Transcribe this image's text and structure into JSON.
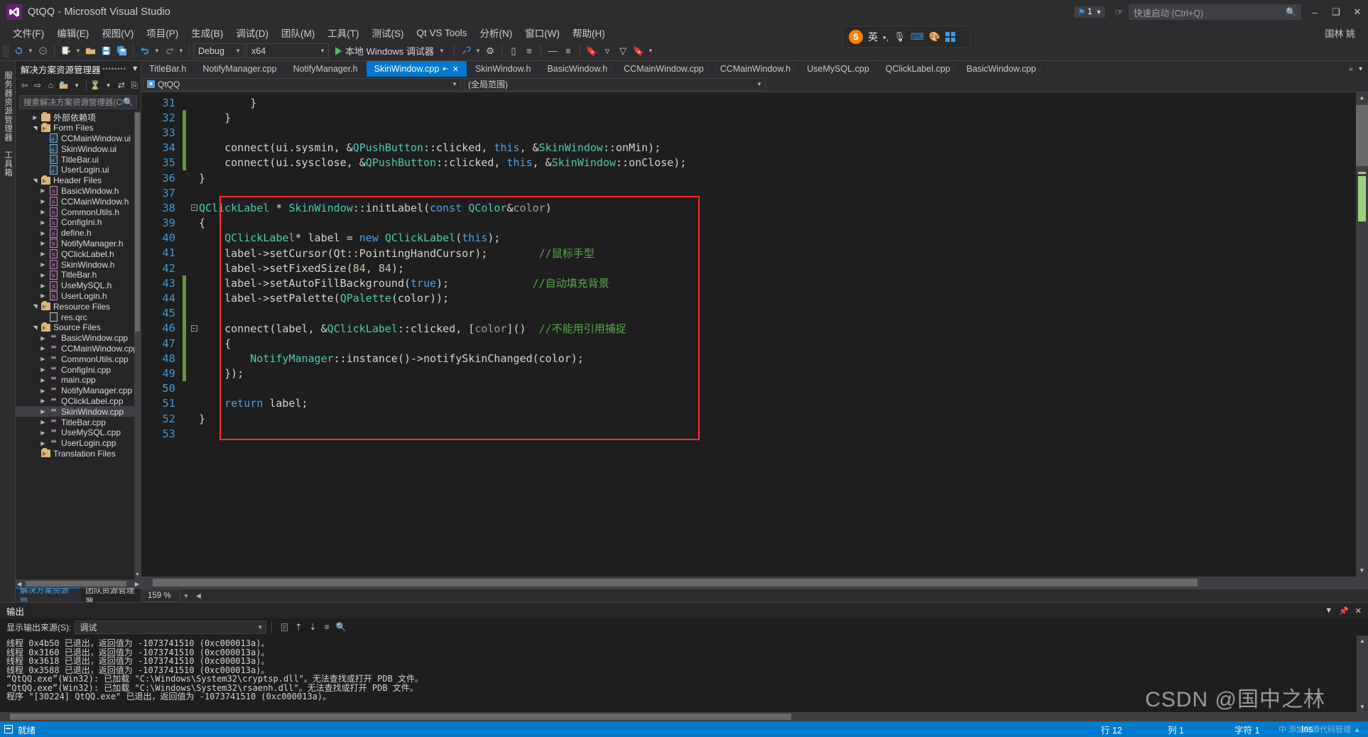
{
  "window": {
    "title": "QtQQ - Microsoft Visual Studio",
    "logo_icon": "visual-studio-logo",
    "notification_count": "1",
    "quick_launch_placeholder": "快速启动 (Ctrl+Q)",
    "user_name": "国林 姚",
    "minimize_label": "–",
    "maximize_label": "❑",
    "close_label": "✕"
  },
  "menu": {
    "items": [
      {
        "label": "文件(F)"
      },
      {
        "label": "编辑(E)"
      },
      {
        "label": "视图(V)"
      },
      {
        "label": "项目(P)"
      },
      {
        "label": "生成(B)"
      },
      {
        "label": "调试(D)"
      },
      {
        "label": "团队(M)"
      },
      {
        "label": "工具(T)"
      },
      {
        "label": "测试(S)"
      },
      {
        "label": "Qt VS Tools"
      },
      {
        "label": "分析(N)"
      },
      {
        "label": "窗口(W)"
      },
      {
        "label": "帮助(H)"
      }
    ]
  },
  "toolbar": {
    "back_icon": "nav-back-icon",
    "forward_icon": "nav-forward-icon",
    "new_item_icon": "new-item-icon",
    "open_icon": "open-file-icon",
    "save_icon": "save-icon",
    "save_all_icon": "save-all-icon",
    "undo_icon": "undo-icon",
    "redo_icon": "redo-icon",
    "config_value": "Debug",
    "platform_value": "x64",
    "run_label": "本地 Windows 调试器",
    "run_icon": "play-icon"
  },
  "ime": {
    "brand_icon": "sogou-logo",
    "mode": "英",
    "dots_icon": "punctuation-icon",
    "mic_icon": "microphone-icon",
    "keyboard_icon": "soft-keyboard-icon",
    "skin_icon": "skin-icon",
    "apps_icon": "toolbox-icon"
  },
  "vstrip": {
    "tabs": [
      {
        "label": "服务器资源管理器"
      },
      {
        "label": "工具箱"
      }
    ]
  },
  "solution_explorer": {
    "title": "解决方案资源管理器",
    "dots": "••••••••",
    "dropdown_icon": "chevron-down-icon",
    "pin_icon": "pin-icon",
    "close_icon": "close-icon",
    "toolbar_icons": [
      "back-icon",
      "forward-icon",
      "home-icon",
      "show-all-files-icon",
      "chevron-down-icon",
      "pending-changes-icon",
      "chevron-down-icon",
      "sync-icon",
      "properties-icon"
    ],
    "search_placeholder": "搜索解决方案资源管理器(Ctrl+;",
    "search_icon": "search-icon",
    "tree": [
      {
        "label": "外部依赖项",
        "depth": 1,
        "arrow": "closed",
        "icon": "folder-ref"
      },
      {
        "label": "Form Files",
        "depth": 1,
        "arrow": "open",
        "icon": "folder-filter"
      },
      {
        "label": "CCMainWindow.ui",
        "depth": 2,
        "arrow": "none",
        "icon": "file-ui"
      },
      {
        "label": "SkinWindow.ui",
        "depth": 2,
        "arrow": "none",
        "icon": "file-ui"
      },
      {
        "label": "TitleBar.ui",
        "depth": 2,
        "arrow": "none",
        "icon": "file-ui"
      },
      {
        "label": "UserLogin.ui",
        "depth": 2,
        "arrow": "none",
        "icon": "file-ui"
      },
      {
        "label": "Header Files",
        "depth": 1,
        "arrow": "open",
        "icon": "folder-filter"
      },
      {
        "label": "BasicWindow.h",
        "depth": 2,
        "arrow": "closed",
        "icon": "file-h"
      },
      {
        "label": "CCMainWindow.h",
        "depth": 2,
        "arrow": "closed",
        "icon": "file-h"
      },
      {
        "label": "CommonUtils.h",
        "depth": 2,
        "arrow": "closed",
        "icon": "file-h"
      },
      {
        "label": "ConfigIni.h",
        "depth": 2,
        "arrow": "closed",
        "icon": "file-h"
      },
      {
        "label": "define.h",
        "depth": 2,
        "arrow": "closed",
        "icon": "file-h"
      },
      {
        "label": "NotifyManager.h",
        "depth": 2,
        "arrow": "closed",
        "icon": "file-h"
      },
      {
        "label": "QClickLabel.h",
        "depth": 2,
        "arrow": "closed",
        "icon": "file-h"
      },
      {
        "label": "SkinWindow.h",
        "depth": 2,
        "arrow": "closed",
        "icon": "file-h"
      },
      {
        "label": "TitleBar.h",
        "depth": 2,
        "arrow": "closed",
        "icon": "file-h"
      },
      {
        "label": "UseMySQL.h",
        "depth": 2,
        "arrow": "closed",
        "icon": "file-h"
      },
      {
        "label": "UserLogin.h",
        "depth": 2,
        "arrow": "closed",
        "icon": "file-h"
      },
      {
        "label": "Resource Files",
        "depth": 1,
        "arrow": "open",
        "icon": "folder-filter"
      },
      {
        "label": "res.qrc",
        "depth": 2,
        "arrow": "none",
        "icon": "file-plain"
      },
      {
        "label": "Source Files",
        "depth": 1,
        "arrow": "open",
        "icon": "folder-filter"
      },
      {
        "label": "BasicWindow.cpp",
        "depth": 2,
        "arrow": "closed",
        "icon": "file-cpp"
      },
      {
        "label": "CCMainWindow.cpp",
        "depth": 2,
        "arrow": "closed",
        "icon": "file-cpp"
      },
      {
        "label": "CommonUtils.cpp",
        "depth": 2,
        "arrow": "closed",
        "icon": "file-cpp"
      },
      {
        "label": "ConfigIni.cpp",
        "depth": 2,
        "arrow": "closed",
        "icon": "file-cpp"
      },
      {
        "label": "main.cpp",
        "depth": 2,
        "arrow": "closed",
        "icon": "file-cpp"
      },
      {
        "label": "NotifyManager.cpp",
        "depth": 2,
        "arrow": "closed",
        "icon": "file-cpp"
      },
      {
        "label": "QClickLabel.cpp",
        "depth": 2,
        "arrow": "closed",
        "icon": "file-cpp"
      },
      {
        "label": "SkinWindow.cpp",
        "depth": 2,
        "arrow": "closed",
        "icon": "file-cpp",
        "selected": true
      },
      {
        "label": "TitleBar.cpp",
        "depth": 2,
        "arrow": "closed",
        "icon": "file-cpp"
      },
      {
        "label": "UseMySQL.cpp",
        "depth": 2,
        "arrow": "closed",
        "icon": "file-cpp"
      },
      {
        "label": "UserLogin.cpp",
        "depth": 2,
        "arrow": "closed",
        "icon": "file-cpp"
      },
      {
        "label": "Translation Files",
        "depth": 1,
        "arrow": "none",
        "icon": "folder-filter"
      }
    ],
    "bottom_tabs": [
      {
        "label": "解决方案资源管...",
        "active": true
      },
      {
        "label": "团队资源管理器",
        "active": false
      }
    ]
  },
  "editor": {
    "tabs": [
      {
        "label": "TitleBar.h",
        "active": false
      },
      {
        "label": "NotifyManager.cpp",
        "active": false
      },
      {
        "label": "NotifyManager.h",
        "active": false
      },
      {
        "label": "SkinWindow.cpp",
        "active": true,
        "pin_icon": "pin-icon",
        "close_icon": "close-icon"
      },
      {
        "label": "SkinWindow.h",
        "active": false
      },
      {
        "label": "BasicWindow.h",
        "active": false
      },
      {
        "label": "CCMainWindow.cpp",
        "active": false
      },
      {
        "label": "CCMainWindow.h",
        "active": false
      },
      {
        "label": "UseMySQL.cpp",
        "active": false
      },
      {
        "label": "QClickLabel.cpp",
        "active": false
      },
      {
        "label": "BasicWindow.cpp",
        "active": false
      }
    ],
    "tab_overflow_left": "«",
    "tab_overflow_dropdown": "▾",
    "scope_project": "QtQQ",
    "scope_member": "(全局范围)",
    "zoom_level": "159 %",
    "lines": [
      {
        "n": "31",
        "changed": false,
        "fold": "",
        "tokens": [
          {
            "t": "        }",
            "c": "plain"
          }
        ]
      },
      {
        "n": "32",
        "changed": true,
        "fold": "",
        "tokens": [
          {
            "t": "    }",
            "c": "plain"
          }
        ]
      },
      {
        "n": "33",
        "changed": true,
        "fold": "",
        "tokens": [
          {
            "t": "",
            "c": "plain"
          }
        ]
      },
      {
        "n": "34",
        "changed": true,
        "fold": "",
        "tokens": [
          {
            "t": "    connect(ui.sysmin, &",
            "c": "plain"
          },
          {
            "t": "QPushButton",
            "c": "type"
          },
          {
            "t": "::clicked, ",
            "c": "plain"
          },
          {
            "t": "this",
            "c": "kw"
          },
          {
            "t": ", &",
            "c": "plain"
          },
          {
            "t": "SkinWindow",
            "c": "type"
          },
          {
            "t": "::onMin);",
            "c": "plain"
          }
        ]
      },
      {
        "n": "35",
        "changed": true,
        "fold": "",
        "tokens": [
          {
            "t": "    connect(ui.sysclose, &",
            "c": "plain"
          },
          {
            "t": "QPushButton",
            "c": "type"
          },
          {
            "t": "::clicked, ",
            "c": "plain"
          },
          {
            "t": "this",
            "c": "kw"
          },
          {
            "t": ", &",
            "c": "plain"
          },
          {
            "t": "SkinWindow",
            "c": "type"
          },
          {
            "t": "::onClose);",
            "c": "plain"
          }
        ]
      },
      {
        "n": "36",
        "changed": false,
        "fold": "",
        "tokens": [
          {
            "t": "}",
            "c": "plain"
          }
        ]
      },
      {
        "n": "37",
        "changed": false,
        "fold": "",
        "tokens": [
          {
            "t": "",
            "c": "plain"
          }
        ]
      },
      {
        "n": "38",
        "changed": false,
        "fold": "minus",
        "tokens": [
          {
            "t": "QClickLabel",
            "c": "type"
          },
          {
            "t": " * ",
            "c": "plain"
          },
          {
            "t": "SkinWindow",
            "c": "type"
          },
          {
            "t": "::initLabel(",
            "c": "plain"
          },
          {
            "t": "const",
            "c": "kw"
          },
          {
            "t": " ",
            "c": "plain"
          },
          {
            "t": "QColor",
            "c": "type"
          },
          {
            "t": "&",
            "c": "plain"
          },
          {
            "t": "color",
            "c": "param"
          },
          {
            "t": ")",
            "c": "plain"
          }
        ]
      },
      {
        "n": "39",
        "changed": false,
        "fold": "",
        "tokens": [
          {
            "t": "{",
            "c": "plain"
          }
        ]
      },
      {
        "n": "40",
        "changed": false,
        "fold": "",
        "tokens": [
          {
            "t": "    ",
            "c": "plain"
          },
          {
            "t": "QClickLabel",
            "c": "type"
          },
          {
            "t": "* label = ",
            "c": "plain"
          },
          {
            "t": "new",
            "c": "kw"
          },
          {
            "t": " ",
            "c": "plain"
          },
          {
            "t": "QClickLabel",
            "c": "type"
          },
          {
            "t": "(",
            "c": "plain"
          },
          {
            "t": "this",
            "c": "kw"
          },
          {
            "t": ");",
            "c": "plain"
          }
        ]
      },
      {
        "n": "41",
        "changed": false,
        "fold": "",
        "tokens": [
          {
            "t": "    label->setCursor(Qt::PointingHandCursor);        ",
            "c": "plain"
          },
          {
            "t": "//鼠标手型",
            "c": "comment"
          }
        ]
      },
      {
        "n": "42",
        "changed": false,
        "fold": "",
        "tokens": [
          {
            "t": "    label->setFixedSize(",
            "c": "plain"
          },
          {
            "t": "84",
            "c": "num"
          },
          {
            "t": ", ",
            "c": "plain"
          },
          {
            "t": "84",
            "c": "num"
          },
          {
            "t": ");",
            "c": "plain"
          }
        ]
      },
      {
        "n": "43",
        "changed": true,
        "fold": "",
        "tokens": [
          {
            "t": "    label->setAutoFillBackground(",
            "c": "plain"
          },
          {
            "t": "true",
            "c": "kw"
          },
          {
            "t": ");             ",
            "c": "plain"
          },
          {
            "t": "//自动填充背景",
            "c": "comment"
          }
        ]
      },
      {
        "n": "44",
        "changed": true,
        "fold": "",
        "tokens": [
          {
            "t": "    label->setPalette(",
            "c": "plain"
          },
          {
            "t": "QPalette",
            "c": "type"
          },
          {
            "t": "(color));",
            "c": "plain"
          }
        ]
      },
      {
        "n": "45",
        "changed": true,
        "fold": "",
        "tokens": [
          {
            "t": "",
            "c": "plain"
          }
        ]
      },
      {
        "n": "46",
        "changed": true,
        "fold": "minus",
        "tokens": [
          {
            "t": "    connect(label, &",
            "c": "plain"
          },
          {
            "t": "QClickLabel",
            "c": "type"
          },
          {
            "t": "::clicked, [",
            "c": "plain"
          },
          {
            "t": "color",
            "c": "param"
          },
          {
            "t": "]()  ",
            "c": "plain"
          },
          {
            "t": "//不能用引用捕捉",
            "c": "comment"
          }
        ]
      },
      {
        "n": "47",
        "changed": true,
        "fold": "",
        "tokens": [
          {
            "t": "    {",
            "c": "plain"
          }
        ]
      },
      {
        "n": "48",
        "changed": true,
        "fold": "",
        "tokens": [
          {
            "t": "        ",
            "c": "plain"
          },
          {
            "t": "NotifyManager",
            "c": "type"
          },
          {
            "t": "::instance()->notifySkinChanged(color);",
            "c": "plain"
          }
        ]
      },
      {
        "n": "49",
        "changed": true,
        "fold": "",
        "tokens": [
          {
            "t": "    });",
            "c": "plain"
          }
        ]
      },
      {
        "n": "50",
        "changed": false,
        "fold": "",
        "tokens": [
          {
            "t": "",
            "c": "plain"
          }
        ]
      },
      {
        "n": "51",
        "changed": false,
        "fold": "",
        "tokens": [
          {
            "t": "    ",
            "c": "plain"
          },
          {
            "t": "return",
            "c": "kw"
          },
          {
            "t": " label;",
            "c": "plain"
          }
        ]
      },
      {
        "n": "52",
        "changed": false,
        "fold": "",
        "tokens": [
          {
            "t": "}",
            "c": "plain"
          }
        ]
      },
      {
        "n": "53",
        "changed": false,
        "fold": "",
        "tokens": [
          {
            "t": "",
            "c": "plain"
          }
        ]
      }
    ],
    "highlight_box_color": "#ff2d2d"
  },
  "output": {
    "title": "输出",
    "dropdown_icon": "chevron-down-icon",
    "pin_icon": "pin-icon",
    "close_icon": "close-icon",
    "source_label": "显示输出来源(S):",
    "source_value": "调试",
    "toolbar_icons": [
      "clear-all-icon",
      "prev-message-icon",
      "next-message-icon",
      "word-wrap-icon",
      "find-icon"
    ],
    "lines": [
      "线程 0x4b50 已退出，返回值为 -1073741510 (0xc000013a)。",
      "线程 0x3160 已退出，返回值为 -1073741510 (0xc000013a)。",
      "线程 0x3618 已退出，返回值为 -1073741510 (0xc000013a)。",
      "线程 0x3588 已退出，返回值为 -1073741510 (0xc000013a)。",
      "“QtQQ.exe”(Win32): 已加载 \"C:\\Windows\\System32\\cryptsp.dll\"。无法查找或打开 PDB 文件。",
      "“QtQQ.exe”(Win32): 已加载 \"C:\\Windows\\System32\\rsaenh.dll\"。无法查找或打开 PDB 文件。",
      "程序 \"[30224] QtQQ.exe\" 已退出，返回值为 -1073741510 (0xc000013a)。"
    ]
  },
  "statusbar": {
    "state_icon": "ready-icon",
    "ready": "就绪",
    "row_label": "行 12",
    "col_label": "列 1",
    "char_label": "字符 1",
    "ins_label": "Ins"
  },
  "watermark": {
    "main": "CSDN @国中之林",
    "sub": "中 添加到源代码管理 ▲"
  },
  "colors": {
    "accent": "#007acc",
    "chrome": "#2d2d30",
    "editor_bg": "#1e1e1e",
    "panel_bg": "#252526",
    "highlight_red": "#ff2d2d",
    "keyword_blue": "#4ea1e0",
    "type_teal": "#4ec9b0",
    "comment_green": "#57a64a",
    "linenum_blue": "#3f9bd4"
  }
}
